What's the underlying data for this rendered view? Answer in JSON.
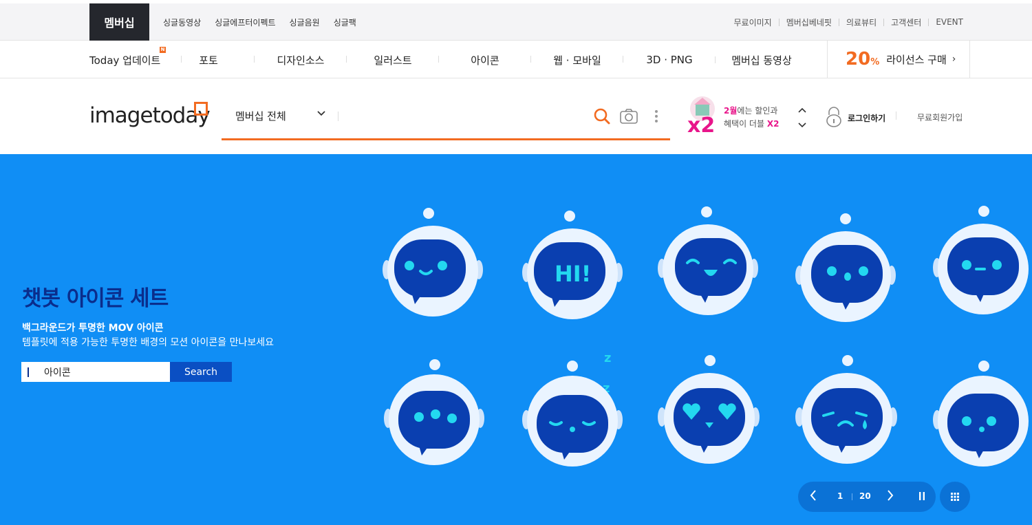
{
  "topbar": {
    "membership": "멤버십",
    "single_links": [
      "싱글동영상",
      "싱글에프터이펙트",
      "싱글음원",
      "싱글팩"
    ],
    "util_links": [
      "무료이미지",
      "멤버십베네핏",
      "의료뷰티",
      "고객센터",
      "EVENT"
    ]
  },
  "catnav": {
    "items": [
      "Today 업데이트",
      "포토",
      "디자인소스",
      "일러스트",
      "아이콘",
      "웹 · 모바일",
      "3D · PNG",
      "멤버십 동영상"
    ],
    "new_badge": "N",
    "license_percent": "20",
    "license_percent_sign": "%",
    "license_label": "라이선스 구매",
    "license_arrow": "›"
  },
  "header": {
    "logo_bold": "image",
    "logo_light": "today",
    "search_scope": "멤버십 전체",
    "search_value": "",
    "promo": {
      "highlight": "2월",
      "line1_rest": "에는 할인과",
      "line2": "혜택이 더블 ",
      "line2_highlight": "X2",
      "badge": "x2"
    },
    "login": "로그인하기",
    "signup": "무료회원가입"
  },
  "hero": {
    "title": "챗봇 아이콘 세트",
    "subtitle": "백그라운드가 투명한 MOV 아이콘",
    "description": "템플릿에 적용 가능한 투명한 배경의 모션 아이콘을 만나보세요",
    "search_value": "아이콘",
    "search_button": "Search",
    "bot_hi_text": "HI!",
    "zz_text": "z",
    "background_color": "#108ef5"
  },
  "slider": {
    "current": "1",
    "total": "20"
  },
  "colors": {
    "accent": "#f26b21",
    "hero_blue": "#108ef5",
    "dark_navy": "#0a2d8c",
    "pink": "#e8158a"
  }
}
